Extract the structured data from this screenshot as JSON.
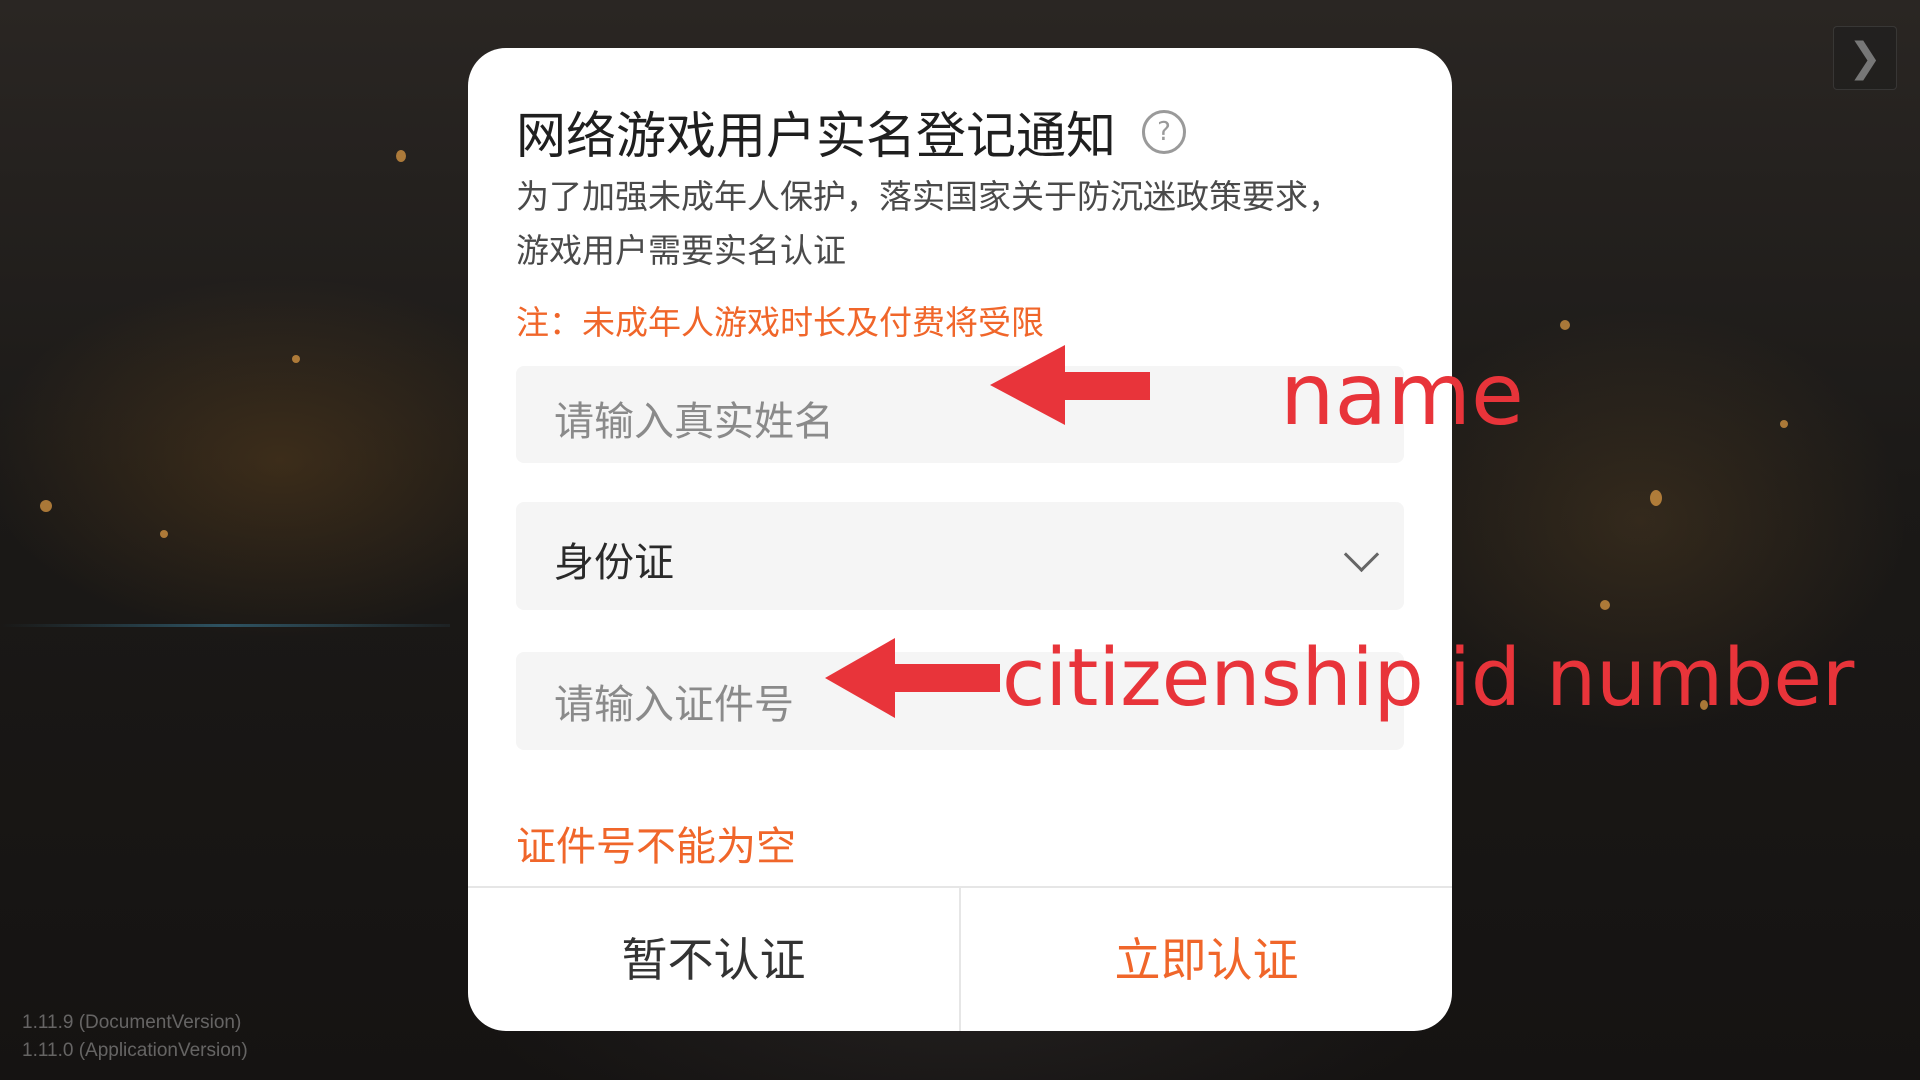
{
  "background": {
    "next_button_glyph": "❯",
    "version_lines": [
      "1.11.9 (DocumentVersion)",
      "1.11.0 (ApplicationVersion)"
    ]
  },
  "dialog": {
    "title": "网络游戏用户实名登记通知",
    "help_icon": "question-circle-icon",
    "help_glyph": "?",
    "description_lines": [
      "为了加强未成年人保护，落实国家关于防沉迷政策要求，",
      "游戏用户需要实名认证"
    ],
    "note": "注：未成年人游戏时长及付费将受限",
    "name_field": {
      "placeholder": "请输入真实姓名",
      "value": ""
    },
    "id_type_select": {
      "selected": "身份证"
    },
    "id_number_field": {
      "placeholder": "请输入证件号",
      "value": ""
    },
    "error_message": "证件号不能为空",
    "buttons": {
      "skip": "暂不认证",
      "verify": "立即认证"
    }
  },
  "annotations": {
    "name_label": "name",
    "id_label": "citizenship id number",
    "color": "#e8343a"
  },
  "colors": {
    "accent": "#f0662a",
    "dialog_bg": "#ffffff",
    "field_bg": "#f5f5f5"
  }
}
